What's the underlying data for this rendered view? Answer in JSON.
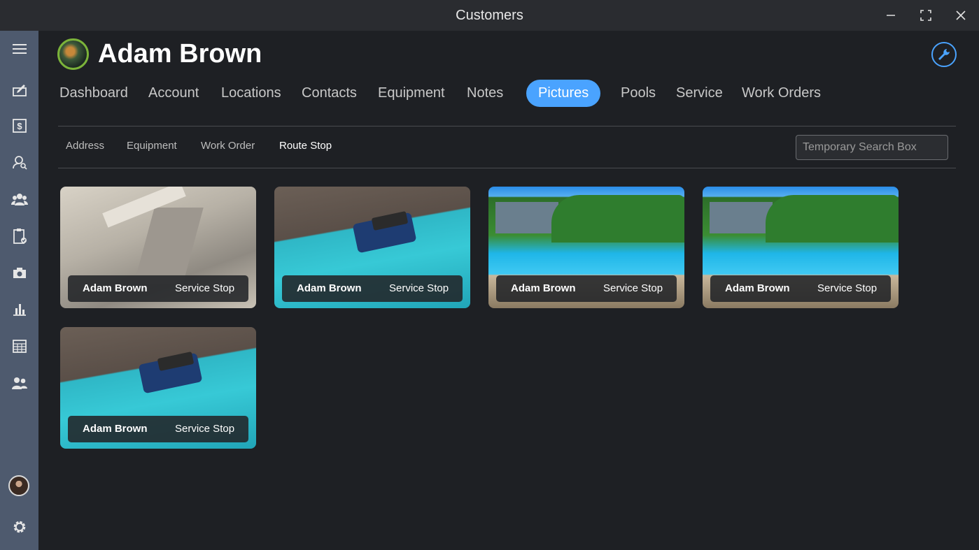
{
  "window": {
    "title": "Customers"
  },
  "header": {
    "customer_name": "Adam Brown"
  },
  "tabs": [
    {
      "label": "Dashboard"
    },
    {
      "label": "Account"
    },
    {
      "label": "Locations"
    },
    {
      "label": "Contacts"
    },
    {
      "label": "Equipment"
    },
    {
      "label": "Notes"
    },
    {
      "label": "Pictures",
      "active": true
    },
    {
      "label": "Pools"
    },
    {
      "label": "Service"
    },
    {
      "label": "Work Orders"
    }
  ],
  "subtabs": [
    {
      "label": "Address"
    },
    {
      "label": "Equipment"
    },
    {
      "label": "Work Order"
    },
    {
      "label": "Route Stop",
      "active": true
    }
  ],
  "search": {
    "placeholder": "Temporary Search Box"
  },
  "pictures": [
    {
      "customer": "Adam Brown",
      "type": "Service Stop",
      "image": "pool-cleaner-dry"
    },
    {
      "customer": "Adam Brown",
      "type": "Service Stop",
      "image": "pool-cleaner-water"
    },
    {
      "customer": "Adam Brown",
      "type": "Service Stop",
      "image": "backyard-pool"
    },
    {
      "customer": "Adam Brown",
      "type": "Service Stop",
      "image": "backyard-pool"
    },
    {
      "customer": "Adam Brown",
      "type": "Service Stop",
      "image": "pool-cleaner-water"
    }
  ],
  "sidebar_icons": [
    "menu-icon",
    "edit-icon",
    "billing-icon",
    "customer-search-icon",
    "team-icon",
    "clipboard-check-icon",
    "camera-icon",
    "chart-icon",
    "calendar-icon",
    "users-icon"
  ],
  "colors": {
    "accent": "#4aa3ff",
    "sidebar": "#4e5a6e",
    "background": "#1e2024"
  }
}
